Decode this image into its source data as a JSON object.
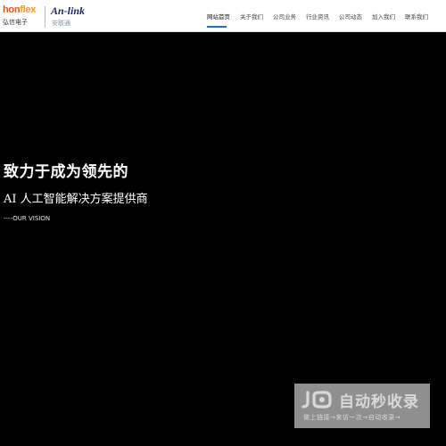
{
  "header": {
    "logo_honflex": {
      "wordmark_part1": "hon",
      "wordmark_part2": "flex",
      "subtitle": "弘信电子"
    },
    "logo_anlink": {
      "wordmark": "An-link",
      "subtitle": "安联通"
    }
  },
  "nav": {
    "items": [
      {
        "label": "网站首页",
        "active": true
      },
      {
        "label": "关于我们",
        "active": false
      },
      {
        "label": "公司业务",
        "active": false
      },
      {
        "label": "行业资讯",
        "active": false
      },
      {
        "label": "公司动态",
        "active": false
      },
      {
        "label": "加入我们",
        "active": false
      },
      {
        "label": "联系我们",
        "active": false
      }
    ],
    "active_color": "#2d6bc9"
  },
  "hero": {
    "title": "致力于成为领先的",
    "subtitle": "AI 人工智能解决方案提供商",
    "vision": "----OUR VISION"
  },
  "watermark": {
    "title": "自动秒收录",
    "slogan": "做上链接→来访一次→自动收录→"
  }
}
